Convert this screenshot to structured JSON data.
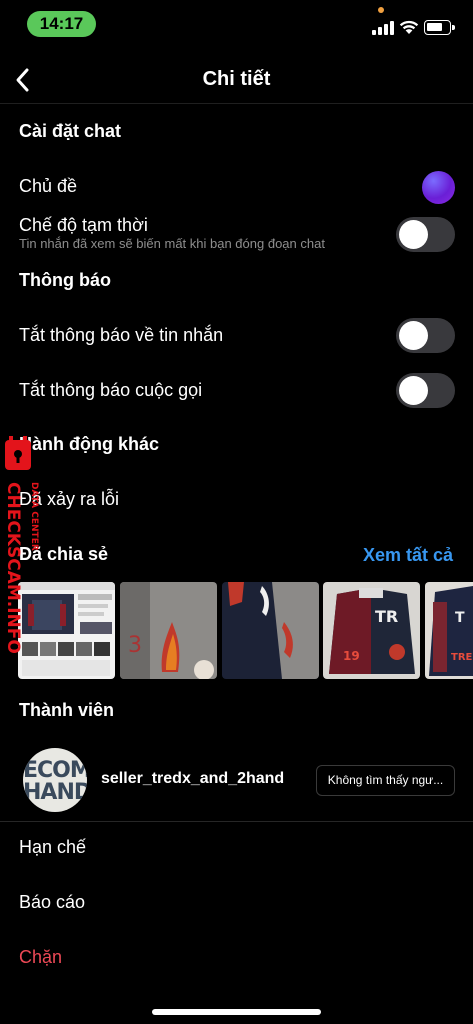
{
  "status_bar": {
    "time": "14:17"
  },
  "header": {
    "title": "Chi tiết"
  },
  "chat_settings": {
    "heading": "Cài đặt chat",
    "theme_label": "Chủ đề",
    "vanish_label": "Chế độ tạm thời",
    "vanish_desc": "Tin nhắn đã xem sẽ biến mất khi bạn đóng đoạn chat"
  },
  "notifications": {
    "heading": "Thông báo",
    "mute_messages": "Tắt thông báo về tin nhắn",
    "mute_calls": "Tắt thông báo cuộc gọi"
  },
  "other_actions": {
    "heading": "Hành động khác",
    "something_wrong": "Đã xảy ra lỗi"
  },
  "shared": {
    "heading": "Đã chia sẻ",
    "see_all": "Xem tất cả"
  },
  "members": {
    "heading": "Thành viên",
    "avatar_text": [
      "ECOM",
      "HAND"
    ],
    "name": "seller_tredx_and_2hand",
    "button": "Không tìm thấy ngư..."
  },
  "actions": {
    "restrict": "Hạn chế",
    "report": "Báo cáo",
    "block": "Chặn"
  },
  "watermark": {
    "brand": "CHECKSCAM.INFO",
    "sub": "DATA CENTER"
  },
  "colors": {
    "accent_blue": "#3897f0",
    "danger_red": "#ed4956",
    "theme_purple": "#6a1fd6"
  }
}
